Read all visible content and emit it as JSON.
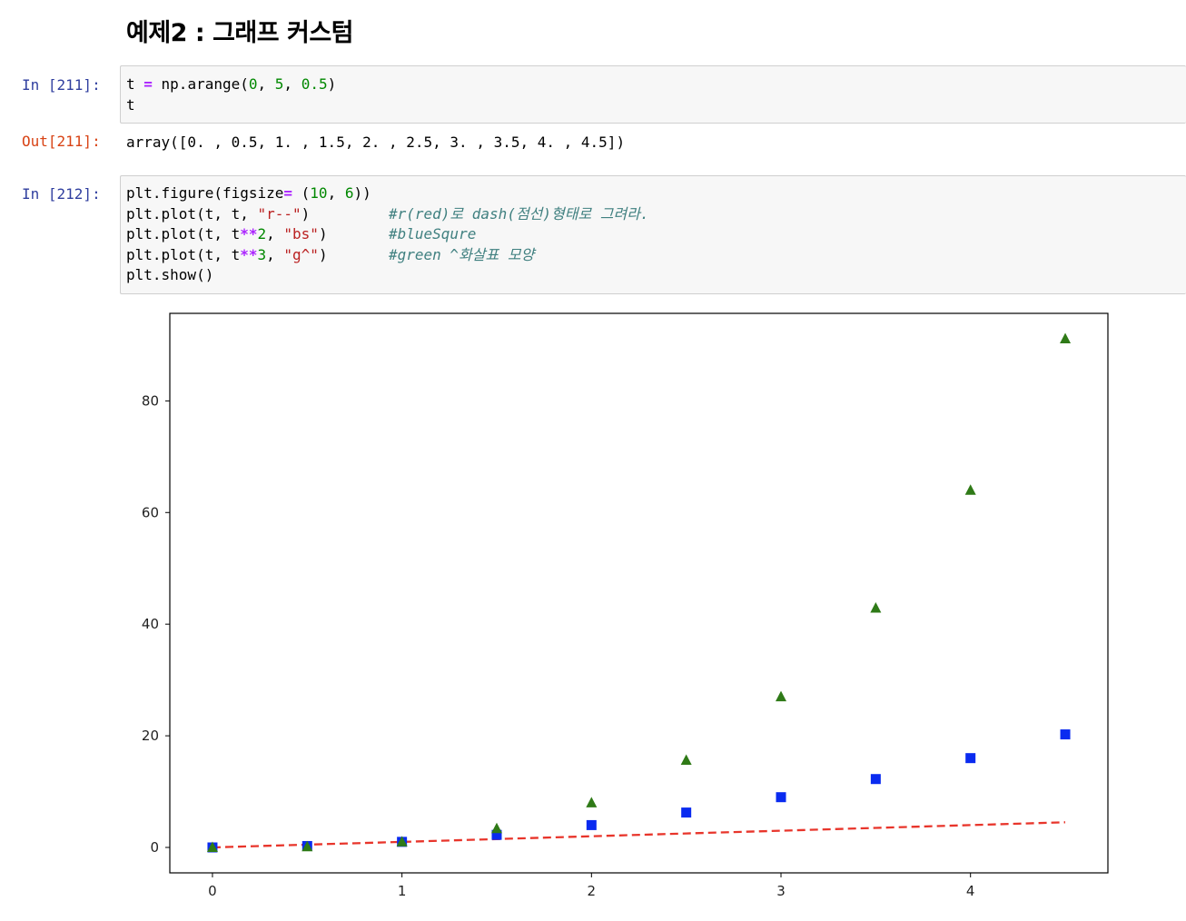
{
  "heading": "예제2 : 그래프 커스텀",
  "cells": [
    {
      "prompt": "In [211]:",
      "lines": [
        [
          {
            "t": "t "
          },
          {
            "t": "=",
            "c": "op"
          },
          {
            "t": " np.arange("
          },
          {
            "t": "0",
            "c": "num"
          },
          {
            "t": ", "
          },
          {
            "t": "5",
            "c": "num"
          },
          {
            "t": ", "
          },
          {
            "t": "0.5",
            "c": "num"
          },
          {
            "t": ")"
          }
        ],
        [
          {
            "t": "t"
          }
        ]
      ]
    },
    {
      "prompt": "In [212]:",
      "lines": [
        [
          {
            "t": "plt.figure(figsize"
          },
          {
            "t": "=",
            "c": "op"
          },
          {
            "t": " ("
          },
          {
            "t": "10",
            "c": "num"
          },
          {
            "t": ", "
          },
          {
            "t": "6",
            "c": "num"
          },
          {
            "t": "))"
          }
        ],
        [
          {
            "t": "plt.plot(t, t, "
          },
          {
            "t": "\"r--\"",
            "c": "str"
          },
          {
            "t": ")         "
          },
          {
            "t": "#r(red)로 dash(점선)형태로 그려라.",
            "c": "com"
          }
        ],
        [
          {
            "t": "plt.plot(t, t"
          },
          {
            "t": "**",
            "c": "op"
          },
          {
            "t": "2",
            "c": "num"
          },
          {
            "t": ", "
          },
          {
            "t": "\"bs\"",
            "c": "str"
          },
          {
            "t": ")       "
          },
          {
            "t": "#blueSqure",
            "c": "com"
          }
        ],
        [
          {
            "t": "plt.plot(t, t"
          },
          {
            "t": "**",
            "c": "op"
          },
          {
            "t": "3",
            "c": "num"
          },
          {
            "t": ", "
          },
          {
            "t": "\"g^\"",
            "c": "str"
          },
          {
            "t": ")       "
          },
          {
            "t": "#green ^화살표 모양",
            "c": "com"
          }
        ],
        [
          {
            "t": "plt.show()"
          }
        ]
      ]
    }
  ],
  "output": {
    "prompt": "Out[211]:",
    "text": "array([0. , 0.5, 1. , 1.5, 2. , 2.5, 3. , 3.5, 4. , 4.5])"
  },
  "chart_data": {
    "type": "line",
    "x": [
      0,
      0.5,
      1,
      1.5,
      2,
      2.5,
      3,
      3.5,
      4,
      4.5
    ],
    "series": [
      {
        "style": "dashed-line",
        "color": "#e8352b",
        "values": [
          0,
          0.5,
          1,
          1.5,
          2,
          2.5,
          3,
          3.5,
          4,
          4.5
        ]
      },
      {
        "style": "square-markers",
        "color": "#0a2bf0",
        "values": [
          0,
          0.25,
          1,
          2.25,
          4,
          6.25,
          9,
          12.25,
          16,
          20.25
        ]
      },
      {
        "style": "triangle-markers",
        "color": "#2f7a17",
        "values": [
          0,
          0.125,
          1,
          3.375,
          8,
          15.625,
          27,
          42.875,
          64,
          91.125
        ]
      }
    ],
    "xlim": [
      -0.225,
      4.725
    ],
    "ylim": [
      -4.556,
      95.681
    ],
    "xticks": [
      0,
      1,
      2,
      3,
      4
    ],
    "yticks": [
      0,
      20,
      40,
      60,
      80
    ],
    "title": "",
    "xlabel": "",
    "ylabel": "",
    "grid": false
  }
}
